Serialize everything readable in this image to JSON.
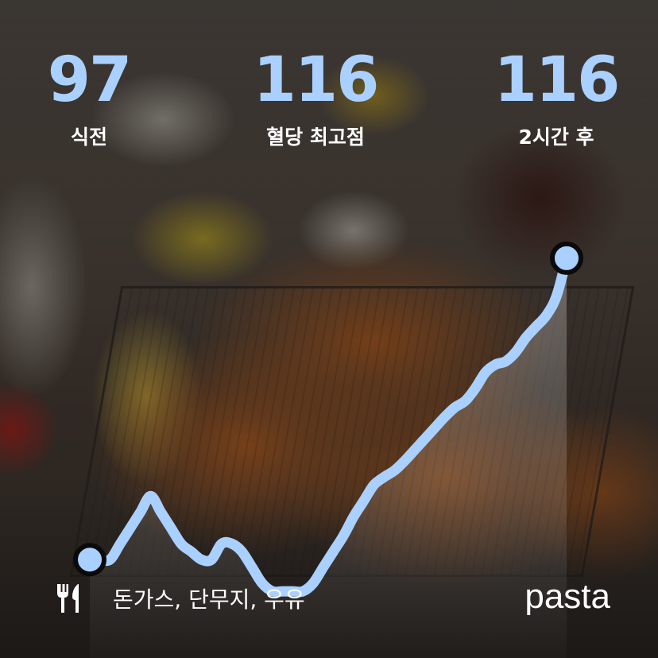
{
  "stats": {
    "before": {
      "value": "97",
      "label": "식전"
    },
    "peak": {
      "value": "116",
      "label": "혈당 최고점"
    },
    "after": {
      "value": "116",
      "label": "2시간 후"
    }
  },
  "chart_data": {
    "type": "line",
    "series": [
      {
        "values": [
          97,
          97,
          97,
          98,
          99,
          100,
          101,
          100,
          99,
          98,
          97.5,
          97,
          97,
          98,
          98,
          97.5,
          96.5,
          95.5,
          95,
          95,
          95,
          95,
          95.5,
          96.5,
          97.5,
          98.5,
          99.7,
          100.7,
          101.7,
          102.2,
          102.6,
          103.2,
          103.9,
          104.6,
          105.3,
          106,
          106.6,
          107,
          107.8,
          108.8,
          109.3,
          109.5,
          110.1,
          111,
          111.7,
          112.4,
          113.6,
          116
        ]
      }
    ],
    "ylim": [
      93,
      118
    ],
    "line_color": "#a9d0ff",
    "marker_fill": "#a9d0ff",
    "marker_stroke": "#0a0a0a"
  },
  "footer": {
    "icon": "utensils-icon",
    "menu": "돈가스, 단무지, 우유",
    "brand": "pasta"
  },
  "colors": {
    "accent": "#a9d0ff",
    "text": "#ffffff"
  }
}
